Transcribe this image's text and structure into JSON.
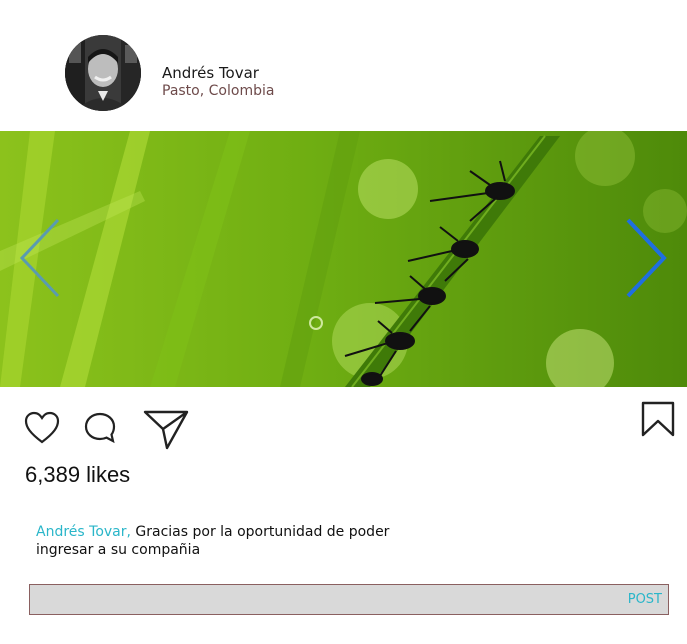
{
  "post": {
    "author_name": "Andrés Tovar",
    "location": "Pasto, Colombia",
    "likes_text": "6,389 likes",
    "caption_author": "Andrés Tovar,",
    "caption_text": " Gracias por la oportunidad de poder ingresar a su compañia"
  },
  "comment": {
    "placeholder": "",
    "post_label": "POST"
  },
  "icons": {
    "like": "heart-icon",
    "comment": "speech-bubble-icon",
    "share": "paper-plane-icon",
    "save": "bookmark-icon",
    "prev": "chevron-left-icon",
    "next": "chevron-right-icon"
  },
  "colors": {
    "accent": "#2ab6c9",
    "arrow_active": "#1f6fe0",
    "arrow_inactive": "#5a9bb0"
  }
}
